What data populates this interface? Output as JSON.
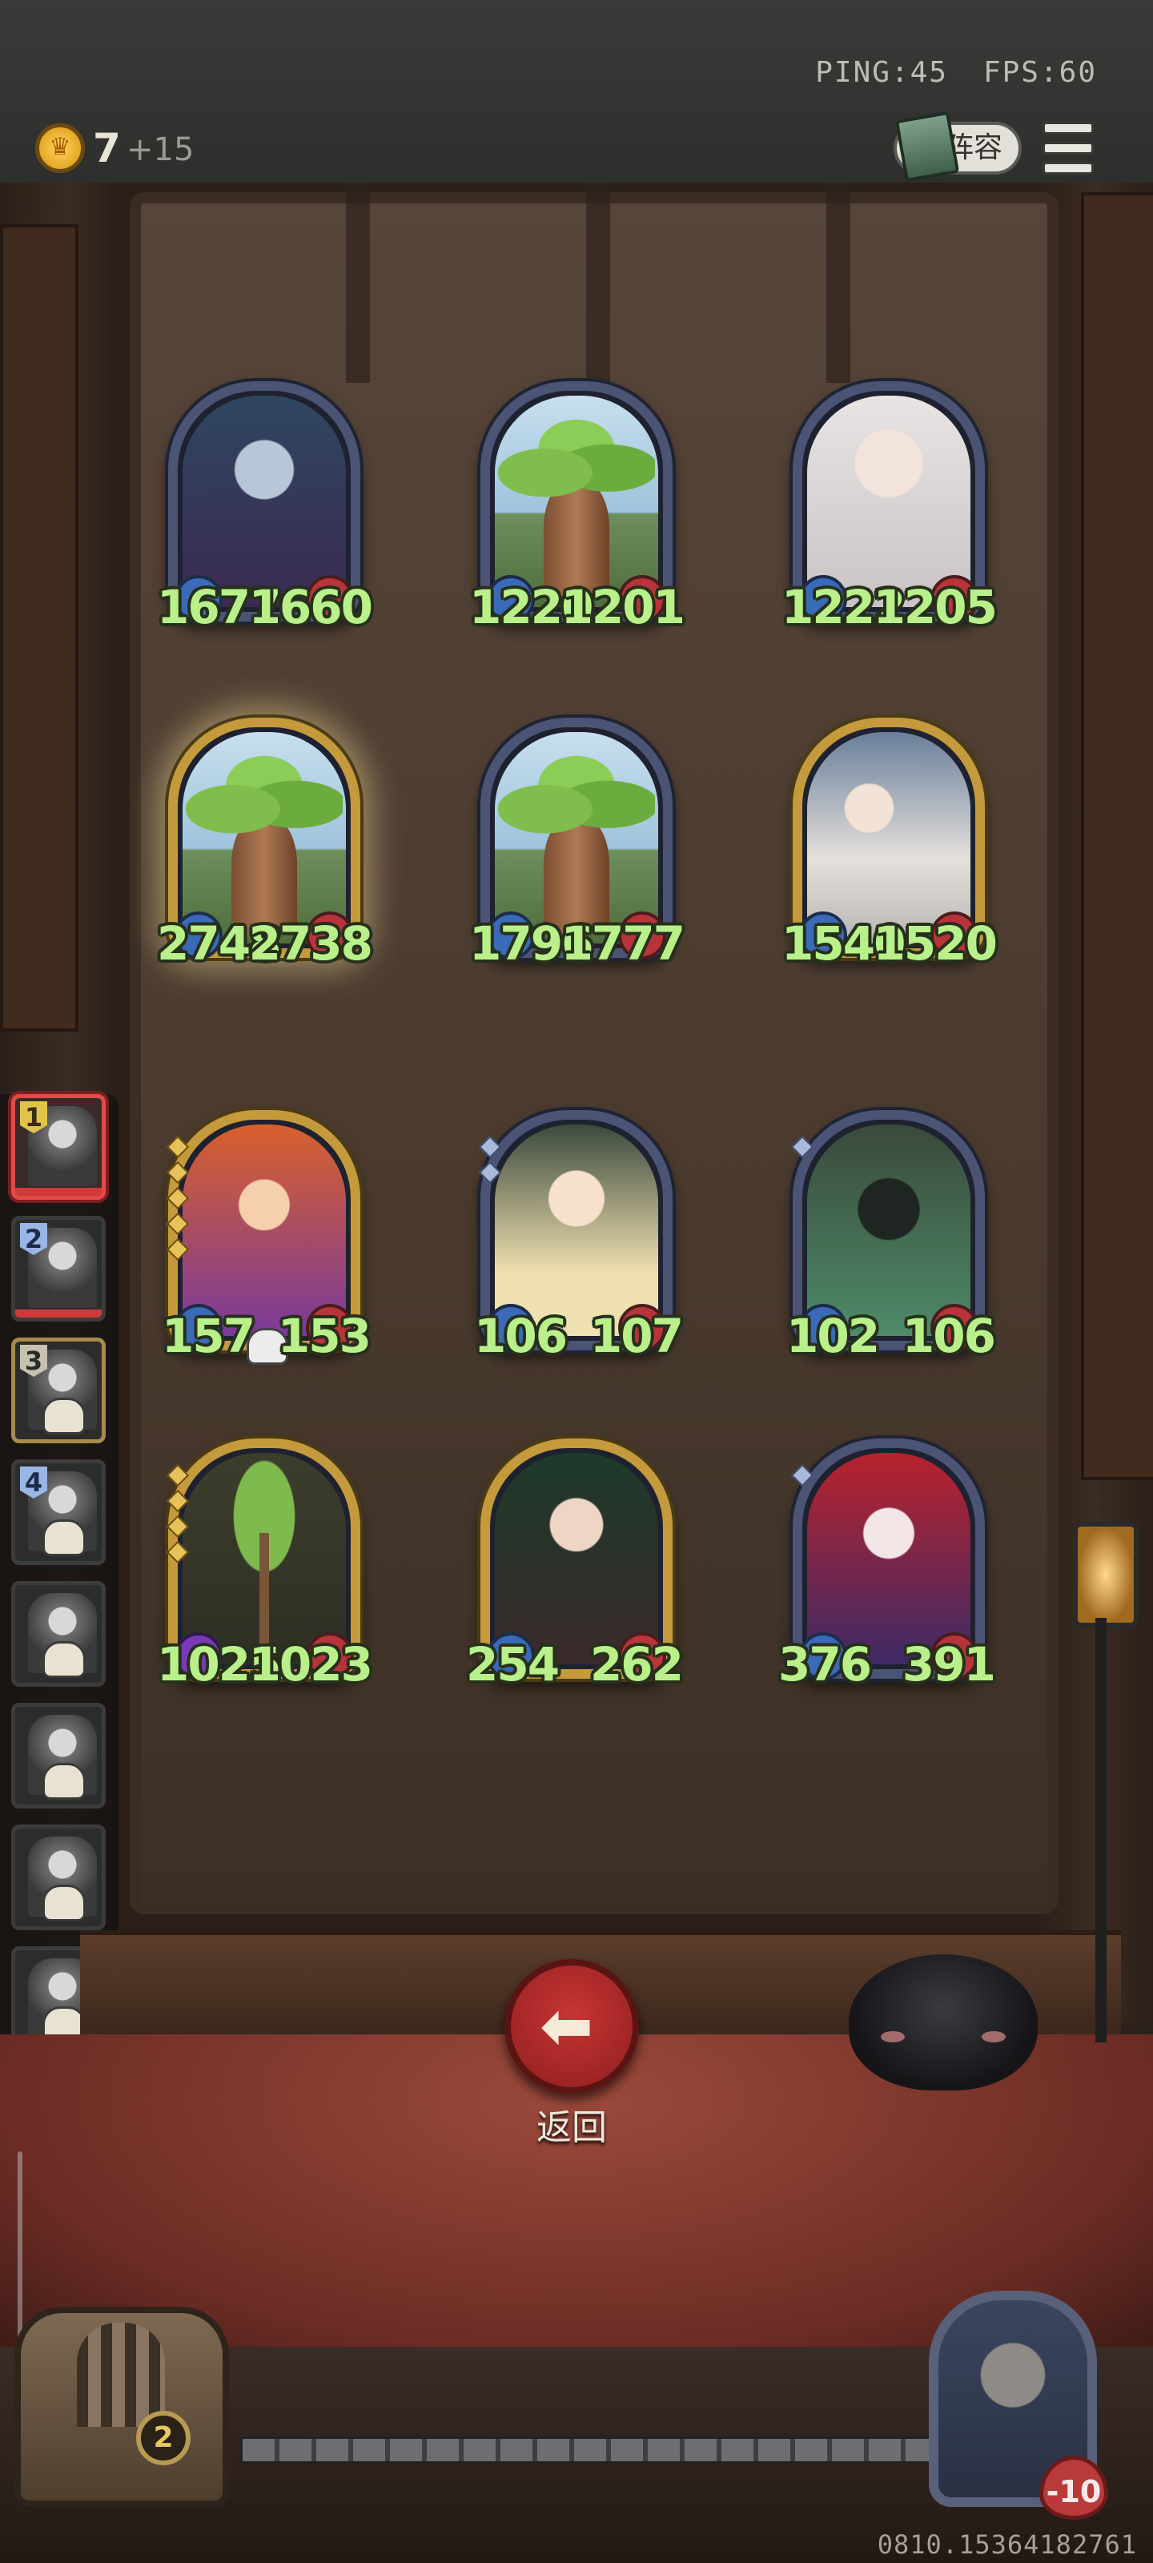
{
  "topbar": {
    "ping": "PING:45",
    "fps": "FPS:60",
    "gold": "7",
    "gold_income": "+15",
    "lineup_label": "阵容"
  },
  "board": {
    "cards": [
      {
        "attack": "1677",
        "health": "1660",
        "frame": "silver"
      },
      {
        "attack": "1220",
        "health": "1201",
        "frame": "silver"
      },
      {
        "attack": "1222",
        "health": "1205",
        "frame": "silver"
      },
      {
        "attack": "2748",
        "health": "2738",
        "frame": "gold"
      },
      {
        "attack": "1796",
        "health": "1777",
        "frame": "silver"
      },
      {
        "attack": "1540",
        "health": "1520",
        "frame": "gold"
      },
      {
        "attack": "157",
        "health": "153",
        "frame": "gold"
      },
      {
        "attack": "106",
        "health": "107",
        "frame": "silver"
      },
      {
        "attack": "102",
        "health": "106",
        "frame": "silver"
      },
      {
        "attack": "1025",
        "health": "1023",
        "frame": "gold"
      },
      {
        "attack": "254",
        "health": "262",
        "frame": "gold"
      },
      {
        "attack": "376",
        "health": "391",
        "frame": "silver"
      }
    ]
  },
  "queue": {
    "ranks": [
      "1",
      "2",
      "3",
      "4"
    ]
  },
  "back_label": "返回",
  "bottom": {
    "cage_count": "2",
    "player_health": "-10",
    "session_id": "0810.15364182761"
  },
  "colors": {
    "stat_text": "#b9f08a",
    "back_button": "#c73535",
    "selected_queue": "#e24a4a"
  }
}
